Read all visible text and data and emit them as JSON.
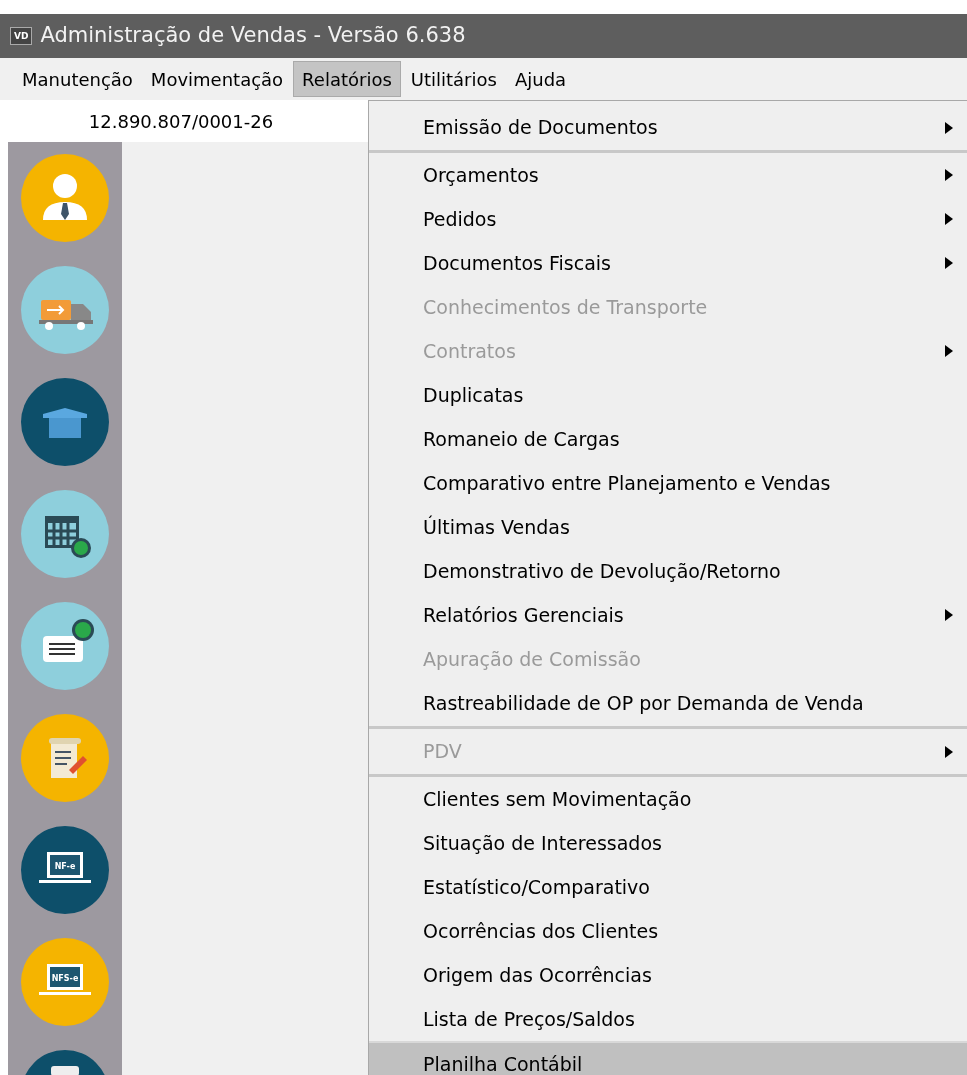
{
  "window": {
    "title": "Administração de Vendas - Versão 6.638",
    "app_badge": "VD"
  },
  "menu_bar": [
    {
      "label": "Manutenção",
      "selected": false
    },
    {
      "label": "Movimentação",
      "selected": false
    },
    {
      "label": "Relatórios",
      "selected": true
    },
    {
      "label": "Utilitários",
      "selected": false
    },
    {
      "label": "Ajuda",
      "selected": false
    }
  ],
  "company_id": "12.890.807/0001-26",
  "sidebar": [
    {
      "kind": "person",
      "color": "#f5b400"
    },
    {
      "kind": "truck",
      "color": "#8ecfdc"
    },
    {
      "kind": "box",
      "color": "#0d4f6a"
    },
    {
      "kind": "calendar",
      "color": "#8ecfdc"
    },
    {
      "kind": "invoice",
      "color": "#8ecfdc"
    },
    {
      "kind": "scroll",
      "color": "#f5b400"
    },
    {
      "kind": "laptop",
      "color": "#0d4f6a",
      "label": "NF-e"
    },
    {
      "kind": "laptop",
      "color": "#f5b400",
      "label": "NFS-e"
    },
    {
      "kind": "partial",
      "color": "#0d4f6a"
    }
  ],
  "dropdown": [
    {
      "label": "Emissão de Documentos",
      "submenu": true,
      "disabled": false,
      "selected": false,
      "separator_after": true
    },
    {
      "label": "Orçamentos",
      "submenu": true,
      "disabled": false,
      "selected": false,
      "separator_after": false
    },
    {
      "label": "Pedidos",
      "submenu": true,
      "disabled": false,
      "selected": false,
      "separator_after": false
    },
    {
      "label": "Documentos Fiscais",
      "submenu": true,
      "disabled": false,
      "selected": false,
      "separator_after": false
    },
    {
      "label": "Conhecimentos de Transporte",
      "submenu": false,
      "disabled": true,
      "selected": false,
      "separator_after": false
    },
    {
      "label": "Contratos",
      "submenu": true,
      "disabled": true,
      "selected": false,
      "separator_after": false
    },
    {
      "label": "Duplicatas",
      "submenu": false,
      "disabled": false,
      "selected": false,
      "separator_after": false
    },
    {
      "label": "Romaneio de Cargas",
      "submenu": false,
      "disabled": false,
      "selected": false,
      "separator_after": false
    },
    {
      "label": "Comparativo entre Planejamento e Vendas",
      "submenu": false,
      "disabled": false,
      "selected": false,
      "separator_after": false
    },
    {
      "label": "Últimas Vendas",
      "submenu": false,
      "disabled": false,
      "selected": false,
      "separator_after": false
    },
    {
      "label": "Demonstrativo de Devolução/Retorno",
      "submenu": false,
      "disabled": false,
      "selected": false,
      "separator_after": false
    },
    {
      "label": "Relatórios Gerenciais",
      "submenu": true,
      "disabled": false,
      "selected": false,
      "separator_after": false
    },
    {
      "label": "Apuração de Comissão",
      "submenu": false,
      "disabled": true,
      "selected": false,
      "separator_after": false
    },
    {
      "label": "Rastreabilidade de OP por Demanda de Venda",
      "submenu": false,
      "disabled": false,
      "selected": false,
      "separator_after": true
    },
    {
      "label": "PDV",
      "submenu": true,
      "disabled": true,
      "selected": false,
      "separator_after": true
    },
    {
      "label": "Clientes sem Movimentação",
      "submenu": false,
      "disabled": false,
      "selected": false,
      "separator_after": false
    },
    {
      "label": "Situação de Interessados",
      "submenu": false,
      "disabled": false,
      "selected": false,
      "separator_after": false
    },
    {
      "label": "Estatístico/Comparativo",
      "submenu": false,
      "disabled": false,
      "selected": false,
      "separator_after": false
    },
    {
      "label": "Ocorrências dos Clientes",
      "submenu": false,
      "disabled": false,
      "selected": false,
      "separator_after": false
    },
    {
      "label": "Origem das Ocorrências",
      "submenu": false,
      "disabled": false,
      "selected": false,
      "separator_after": false
    },
    {
      "label": "Lista de Preços/Saldos",
      "submenu": false,
      "disabled": false,
      "selected": false,
      "separator_after": false
    },
    {
      "label": "Planilha Contábil",
      "submenu": false,
      "disabled": false,
      "selected": true,
      "separator_after": false
    }
  ]
}
